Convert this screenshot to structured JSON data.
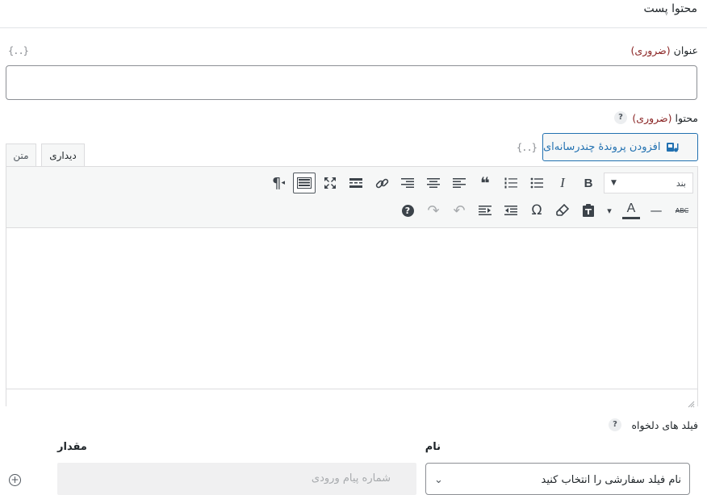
{
  "section": {
    "title": "محتوا پست"
  },
  "title_field": {
    "label": "عنوان",
    "required": "(ضروری)",
    "merge_tag": "{..}",
    "value": ""
  },
  "content_field": {
    "label": "محتوا",
    "required": "(ضروری)",
    "help": "?",
    "merge_tag": "{..}"
  },
  "media_button": {
    "label": "افزودن پروندهٔ چندرسانه‌ای"
  },
  "editor_tabs": {
    "visual": "دیداری",
    "text": "متن"
  },
  "toolbar": {
    "format_select": "بند",
    "row1": [
      {
        "name": "bold-icon",
        "glyph": "B"
      },
      {
        "name": "italic-icon",
        "glyph": "I"
      },
      {
        "name": "bullet-list-icon",
        "glyph": "☰"
      },
      {
        "name": "numbered-list-icon",
        "glyph": "≡"
      },
      {
        "name": "blockquote-icon",
        "glyph": "❝"
      },
      {
        "name": "align-left-icon",
        "glyph": "≡"
      },
      {
        "name": "align-center-icon",
        "glyph": "≡"
      },
      {
        "name": "align-right-icon",
        "glyph": "≡"
      },
      {
        "name": "link-icon",
        "glyph": "🔗"
      },
      {
        "name": "read-more-icon",
        "glyph": "▬"
      },
      {
        "name": "fullscreen-icon",
        "glyph": "⤧"
      },
      {
        "name": "toolbar-toggle-icon",
        "glyph": "⌨"
      },
      {
        "name": "rtl-direction-icon",
        "glyph": "¶"
      }
    ],
    "row2": [
      {
        "name": "strikethrough-icon",
        "glyph": "ABC"
      },
      {
        "name": "horizontal-line-icon",
        "glyph": "—"
      },
      {
        "name": "text-color-icon",
        "glyph": "A"
      },
      {
        "name": "color-dropdown-icon",
        "glyph": "▾"
      },
      {
        "name": "paste-text-icon",
        "glyph": "📋"
      },
      {
        "name": "clear-formatting-icon",
        "glyph": "⌫"
      },
      {
        "name": "special-character-icon",
        "glyph": "Ω"
      },
      {
        "name": "outdent-icon",
        "glyph": "⇤"
      },
      {
        "name": "indent-icon",
        "glyph": "⇥"
      },
      {
        "name": "undo-icon",
        "glyph": "↶"
      },
      {
        "name": "redo-icon",
        "glyph": "↷"
      },
      {
        "name": "keyboard-help-icon",
        "glyph": "?"
      }
    ]
  },
  "custom_fields": {
    "label": "فیلد های دلخواه",
    "help": "?",
    "name_header": "نام",
    "value_header": "مقدار",
    "name_placeholder": "نام فیلد سفارشی را انتخاب کنید",
    "value_placeholder": "شماره پیام ورودی"
  },
  "colors": {
    "accent": "#2271b1",
    "required": "#8a2424",
    "border": "#dcdcde"
  }
}
